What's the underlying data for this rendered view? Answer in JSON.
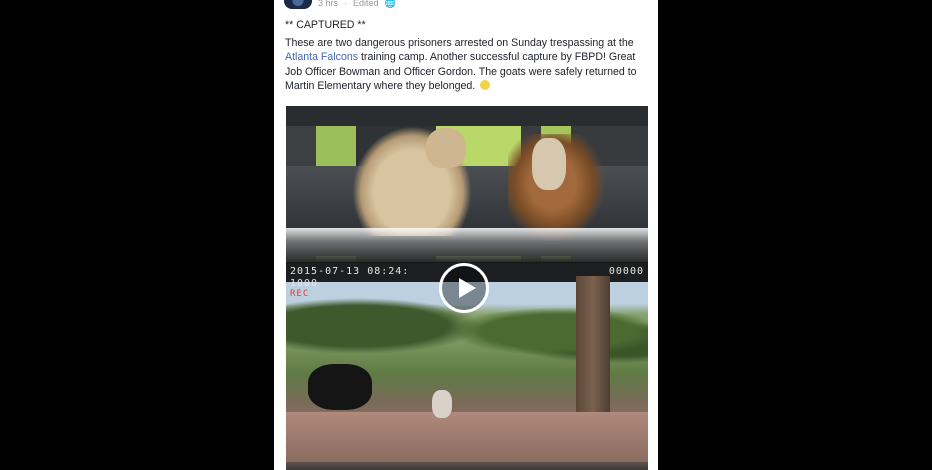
{
  "post": {
    "timestamp": "3 hrs",
    "separator": "·",
    "edited": "Edited",
    "privacy_icon": "globe-icon",
    "title": "** CAPTURED **",
    "body_1": "These are two dangerous prisoners arrested on Sunday trespassing at the ",
    "link": "Atlanta Falcons",
    "body_2": " training camp. Another successful capture by FBPD! Great Job Officer Bowman and Officer Gordon. The goats were safely returned to Martin Elementary where they belonged.",
    "emoji_icon": "smile-emoji-icon"
  },
  "video": {
    "timestamp_overlay": "2015-07-13  08:24:",
    "counter_overlay": "00000",
    "sub_overlay": "1000",
    "red_overlay": "REC",
    "play_icon": "play-icon"
  }
}
